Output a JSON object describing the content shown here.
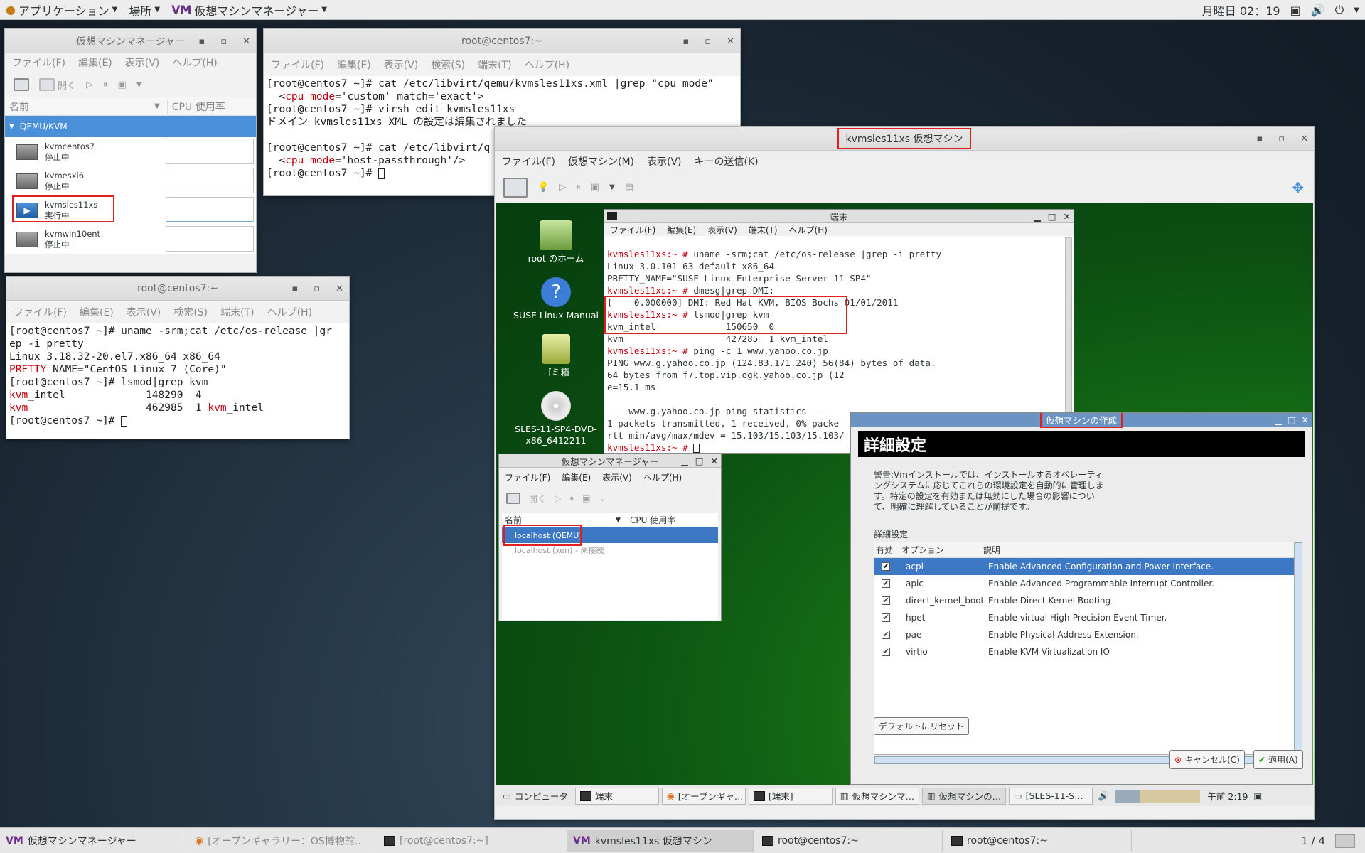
{
  "topbar": {
    "apps": "アプリケーション",
    "places": "場所",
    "active_app": "仮想マシンマネージャー",
    "clock": "月曜日 02：19"
  },
  "vmm": {
    "title": "仮想マシンマネージャー",
    "menu": [
      "ファイル(F)",
      "編集(E)",
      "表示(V)",
      "ヘルプ(H)"
    ],
    "toolbar_open": "開く",
    "col_name": "名前",
    "col_cpu": "CPU 使用率",
    "group": "QEMU/KVM",
    "vms": [
      {
        "name": "kvmcentos7",
        "status": "停止中"
      },
      {
        "name": "kvmesxi6",
        "status": "停止中"
      },
      {
        "name": "kvmsles11xs",
        "status": "実行中"
      },
      {
        "name": "kvmwin10ent",
        "status": "停止中"
      }
    ]
  },
  "term1": {
    "title": "root@centos7:~",
    "menu": [
      "ファイル(F)",
      "編集(E)",
      "表示(V)",
      "検索(S)",
      "端末(T)",
      "ヘルプ(H)"
    ],
    "l1": "[root@centos7 ~]# cat /etc/libvirt/qemu/kvmsles11xs.xml |grep \"cpu mode\"",
    "l2a": "  <",
    "l2b": "cpu",
    "l2c": " ",
    "l2d": "mode",
    "l2e": "='custom' match='exact'>",
    "l3": "[root@centos7 ~]# virsh edit kvmsles11xs",
    "l4": "ドメイン kvmsles11xs XML の設定は編集されました",
    "l5": "[root@centos7 ~]# cat /etc/libvirt/q",
    "l6a": "  <",
    "l6b": "cpu",
    "l6c": " ",
    "l6d": "mode",
    "l6e": "='host-passthrough'/>",
    "l7": "[root@centos7 ~]# "
  },
  "term2": {
    "title": "root@centos7:~",
    "menu": [
      "ファイル(F)",
      "編集(E)",
      "表示(V)",
      "検索(S)",
      "端末(T)",
      "ヘルプ(H)"
    ],
    "l1": "[root@centos7 ~]# uname -srm;cat /etc/os-release |gr",
    "l2": "ep -i pretty",
    "l3": "Linux 3.18.32-20.el7.x86_64 x86_64",
    "l4a": "PRETTY",
    "l4b": "_NAME=\"CentOS Linux 7 (Core)\"",
    "l5": "[root@centos7 ~]# lsmod|grep kvm",
    "l6a": "kvm",
    "l6b": "_intel             148290  4",
    "l7a": "kvm",
    "l7b": "                   462985  1 ",
    "l7c": "kvm",
    "l7d": "_intel",
    "l8": "[root@centos7 ~]# "
  },
  "vmwin": {
    "title": "kvmsles11xs 仮想マシン",
    "menu": [
      "ファイル(F)",
      "仮想マシン(M)",
      "表示(V)",
      "キーの送信(K)"
    ]
  },
  "sles": {
    "desktop": [
      "root のホーム",
      "SUSE Linux Manual",
      "ゴミ箱",
      "SLES-11-SP4-DVD-x86_6412211"
    ],
    "term": {
      "title": "端末",
      "menu": [
        "ファイル(F)",
        "編集(E)",
        "表示(V)",
        "端末(T)",
        "ヘルプ(H)"
      ],
      "prompt": "kvmsles11xs:~ #",
      "c1": " uname -srm;cat /etc/os-release |grep -i pretty",
      "o1": "Linux 3.0.101-63-default x86_64",
      "o2": "PRETTY_NAME=\"SUSE Linux Enterprise Server 11 SP4\"",
      "c2": " dmesg|grep DMI:",
      "o3": "[    0.000000] DMI: Red Hat KVM, BIOS Bochs 01/01/2011",
      "c3": " lsmod|grep kvm",
      "o4": "kvm_intel             150650  0",
      "o5": "kvm                   427285  1 kvm_intel",
      "c4": " ping -c 1 www.yahoo.co.jp",
      "o6": "PING www.g.yahoo.co.jp (124.83.171.240) 56(84) bytes of data.",
      "o7": "64 bytes from f7.top.vip.ogk.yahoo.co.jp (12",
      "o8": "e=15.1 ms",
      "o9": "--- www.g.yahoo.co.jp ping statistics ---",
      "o10": "1 packets transmitted, 1 received, 0% packe",
      "o11": "rtt min/avg/max/mdev = 15.103/15.103/15.103/"
    },
    "vmm": {
      "title": "仮想マシンマネージャー",
      "menu": [
        "ファイル(F)",
        "編集(E)",
        "表示(V)",
        "ヘルプ(H)"
      ],
      "open": "開く",
      "col_name": "名前",
      "col_cpu": "CPU 使用率",
      "row1": "localhost (QEMU)",
      "row2": "localhost (xen) - 未接続"
    },
    "create": {
      "title": "仮想マシンの作成",
      "header": "詳細設定",
      "warning": "警告:Vmインストールでは、インストールするオペレーティングシステムに応じてこれらの環境設定を自動的に管理します。特定の設定を有効または無効にした場合の影響について、明確に理解していることが前提です。",
      "section": "詳細設定",
      "col_enabled": "有効",
      "col_option": "オプション",
      "col_desc": "説明",
      "options": [
        {
          "name": "acpi",
          "desc": "Enable Advanced Configuration and Power Interface."
        },
        {
          "name": "apic",
          "desc": "Enable Advanced Programmable Interrupt Controller."
        },
        {
          "name": "direct_kernel_boot",
          "desc": "Enable Direct Kernel Booting"
        },
        {
          "name": "hpet",
          "desc": "Enable virtual High-Precision Event Timer."
        },
        {
          "name": "pae",
          "desc": "Enable Physical Address Extension."
        },
        {
          "name": "virtio",
          "desc": "Enable KVM Virtualization IO"
        }
      ],
      "reset": "デフォルトにリセット",
      "cancel": "キャンセル(C)",
      "apply": "適用(A)"
    },
    "taskbar": {
      "computer": "コンピュータ",
      "items": [
        "端末",
        "[オープンギャ…",
        "[端末]",
        "仮想マシンマ…",
        "仮想マシンの…",
        "[SLES-11-S…"
      ],
      "clock": "午前 2:19"
    }
  },
  "bottombar": {
    "items": [
      "仮想マシンマネージャー",
      "[オープンギャラリー：OS博物館…",
      "[root@centos7:~]",
      "kvmsles11xs 仮想マシン",
      "root@centos7:~",
      "root@centos7:~"
    ],
    "pager": "1 / 4"
  }
}
